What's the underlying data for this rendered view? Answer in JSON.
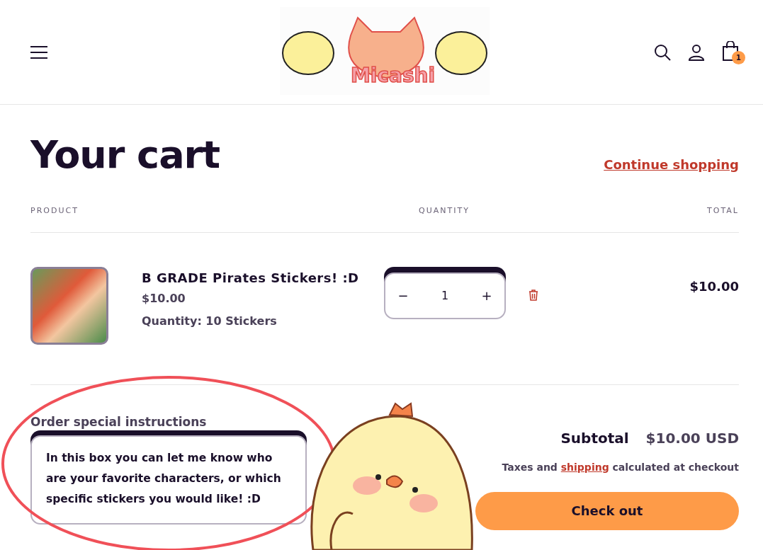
{
  "header": {
    "logo_text": "Micashi",
    "cart_count": "1"
  },
  "title": "Your cart",
  "continue_link": "Continue shopping",
  "columns": [
    "PRODUCT",
    "QUANTITY",
    "TOTAL"
  ],
  "items": [
    {
      "name": "B GRADE Pirates Stickers! :D",
      "price": "$10.00",
      "option": "Quantity: 10 Stickers",
      "quantity": "1",
      "total": "$10.00",
      "minus": "−",
      "plus": "+"
    }
  ],
  "instructions": {
    "label": "Order special instructions",
    "value": "In this box you can let me know who are your favorite characters, or which specific stickers you would like! :D"
  },
  "summary": {
    "subtotal_label": "Subtotal",
    "subtotal": "$10.00 USD",
    "tax_before": "Taxes and",
    "tax_link": "shipping",
    "tax_after": "calculated at checkout",
    "checkout": "Check out"
  }
}
